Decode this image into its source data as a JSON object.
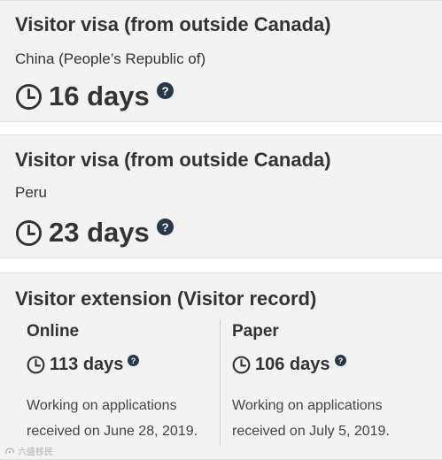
{
  "cards": [
    {
      "title": "Visitor visa (from outside Canada)",
      "country": "China (People’s Republic of)",
      "processing_time": "16 days"
    },
    {
      "title": "Visitor visa (from outside Canada)",
      "country": "Peru",
      "processing_time": "23 days"
    }
  ],
  "extension": {
    "title": "Visitor extension (Visitor record)",
    "online": {
      "label": "Online",
      "processing_time": "113 days",
      "note": "Working on applications received on June 28, 2019."
    },
    "paper": {
      "label": "Paper",
      "processing_time": "106 days",
      "note": "Working on applications received on July 5, 2019."
    }
  },
  "watermark": "六盛移民",
  "icons": {
    "clock": "clock-icon",
    "help": "question-circle-icon"
  },
  "colors": {
    "card_bg": "#f3f3f3",
    "text": "#333333",
    "icon_dark": "#26374a"
  }
}
